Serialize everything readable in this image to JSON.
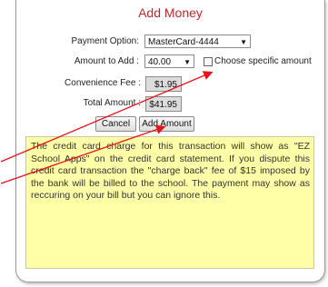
{
  "dialog": {
    "title": "Add Money"
  },
  "form": {
    "payment_option_label": "Payment Option:",
    "payment_option_value": "MasterCard-4444",
    "amount_label": "Amount to Add :",
    "amount_value": "40.00",
    "choose_amount_label": "Choose specific amount",
    "convenience_fee_label": "Convenience Fee :",
    "convenience_fee_value": "$1.95",
    "total_amount_label": "Total Amount :",
    "total_amount_value": "$41.95"
  },
  "buttons": {
    "cancel": "Cancel",
    "add_amount": "Add Amount"
  },
  "notice": {
    "text": "The credit card charge for this transaction will show as \"EZ School Apps\" on the credit card statement. If you dispute this credit card transaction the \"charge back\" fee of $15 imposed by the bank will be billed to the school. The payment may show as reccuring on your bill but you can ignore this."
  },
  "colors": {
    "title": "#c0282d",
    "notice_bg": "#ffffa8",
    "arrow": "#e8121b"
  }
}
